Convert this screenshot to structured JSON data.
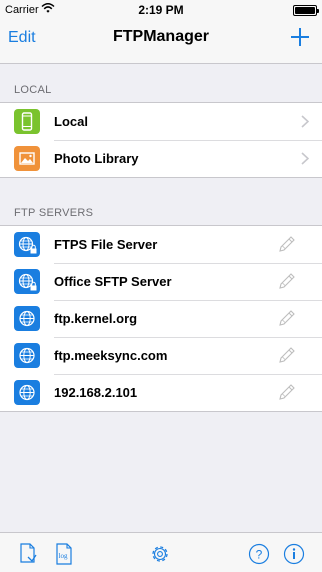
{
  "status_bar": {
    "carrier": "Carrier",
    "time": "2:19 PM",
    "battery_level": 1.0
  },
  "nav_bar": {
    "edit_label": "Edit",
    "title": "FTPManager",
    "add_icon": "plus-icon"
  },
  "sections": {
    "local": {
      "header": "LOCAL",
      "items": [
        {
          "label": "Local",
          "icon": "phone-icon",
          "icon_color": "#7ac32e"
        },
        {
          "label": "Photo Library",
          "icon": "photo-icon",
          "icon_color": "#f0923a"
        }
      ]
    },
    "ftp": {
      "header": "FTP SERVERS",
      "items": [
        {
          "label": "FTPS File Server",
          "icon": "globe-lock-icon"
        },
        {
          "label": "Office SFTP Server",
          "icon": "globe-lock-icon"
        },
        {
          "label": "ftp.kernel.org",
          "icon": "globe-icon"
        },
        {
          "label": "ftp.meeksync.com",
          "icon": "globe-icon"
        },
        {
          "label": "192.168.2.101",
          "icon": "globe-icon"
        }
      ]
    }
  },
  "tab_bar": {
    "items": [
      "document-inbox-icon",
      "log-icon",
      "gear-icon",
      "help-icon",
      "info-icon"
    ]
  },
  "colors": {
    "accent": "#1a7ee0",
    "server_icon": "#1a7ee0",
    "background": "#efeff4"
  }
}
